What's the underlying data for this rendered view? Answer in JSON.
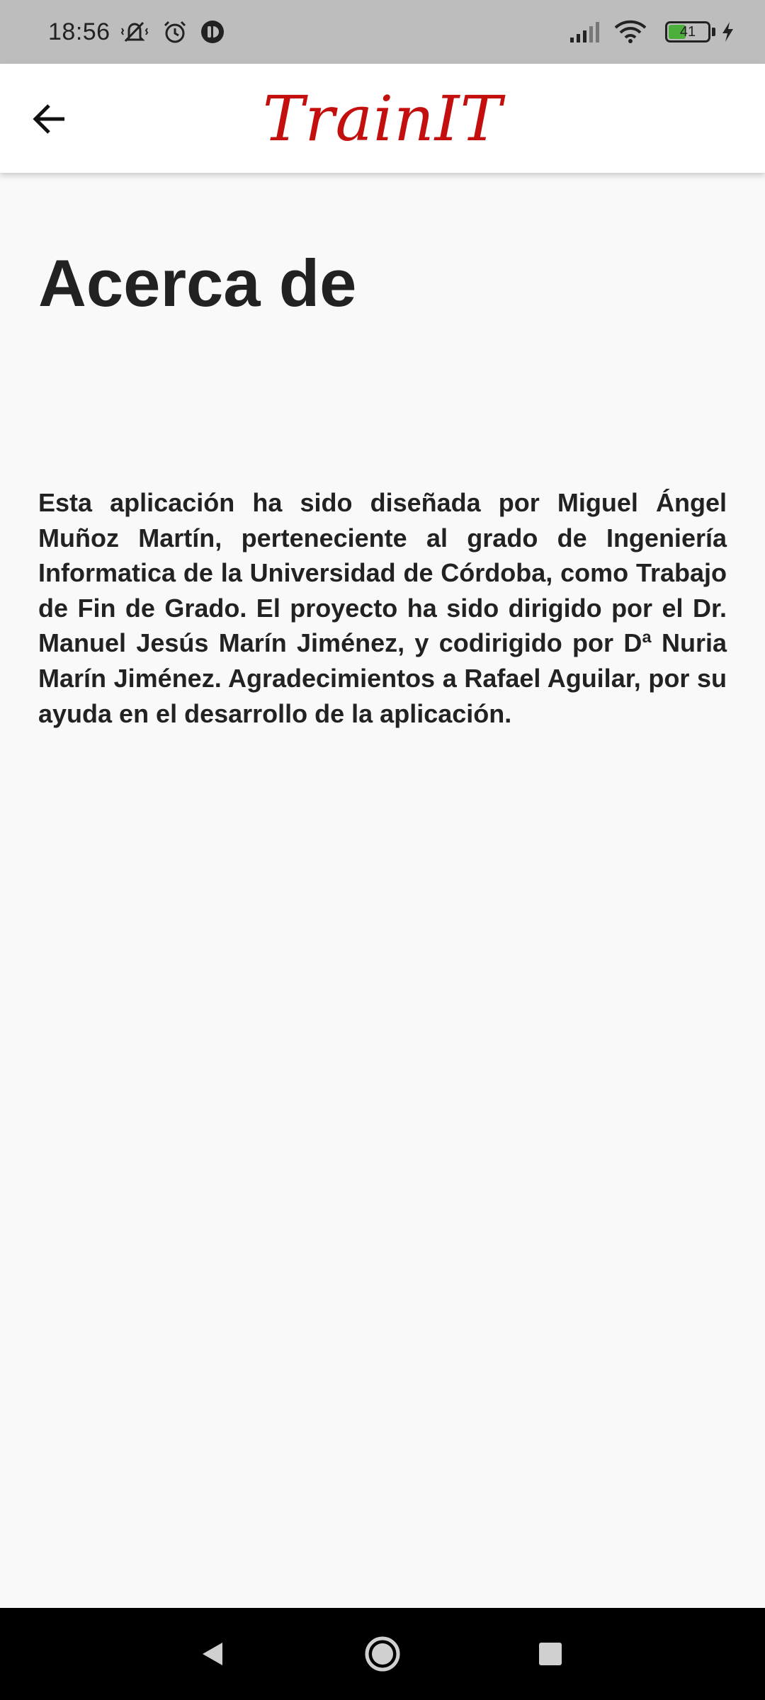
{
  "status_bar": {
    "time": "18:56",
    "battery_level": "41",
    "icons": [
      "mute-vibrate-icon",
      "alarm-icon",
      "app-notification-icon",
      "signal-icon",
      "wifi-icon",
      "battery-icon",
      "charging-icon"
    ]
  },
  "app_bar": {
    "logo_text": "TrainIT",
    "back_icon": "arrow-left-icon",
    "logo_color": "#c40f0f"
  },
  "page": {
    "title": "Acerca de",
    "body": "Esta aplicación ha sido diseñada por Miguel Ángel Muñoz Martín, perteneciente al grado de Ingeniería Informatica de la Universidad de Córdoba, como Trabajo de Fin de Grado. El proyecto ha sido dirigido por el Dr. Manuel Jesús Marín Jiménez, y codirigido por Dª Nuria Marín Jiménez. Agradecimientos a Rafael Aguilar, por su ayuda en el desarrollo de la aplicación."
  },
  "nav_bar": {
    "buttons": [
      "back-triangle-icon",
      "home-circle-icon",
      "recents-square-icon"
    ]
  }
}
